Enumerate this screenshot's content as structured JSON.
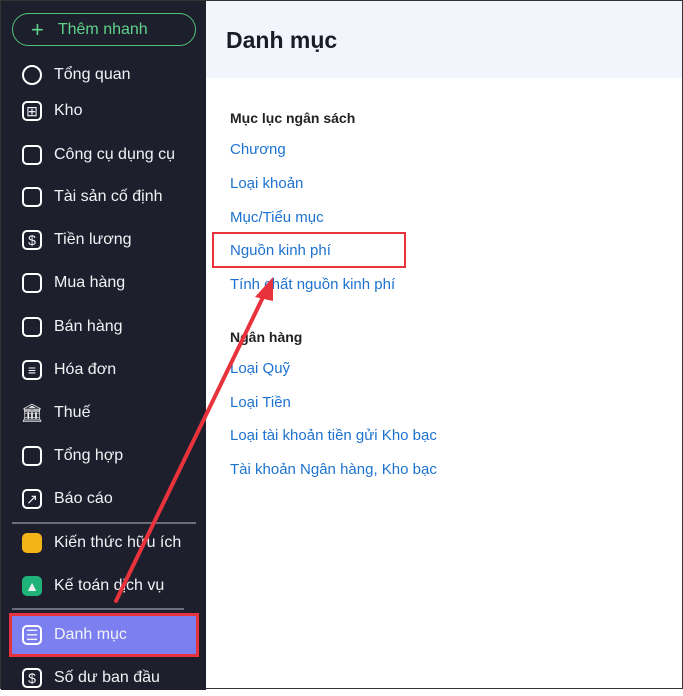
{
  "sidebar": {
    "quick_add": "Thêm nhanh",
    "items": [
      {
        "label": "Tổng quan",
        "icon": "pie-chart-icon"
      },
      {
        "label": "Kho",
        "icon": "warehouse-icon"
      },
      {
        "label": "Công cụ dụng cụ",
        "icon": "tools-icon"
      },
      {
        "label": "Tài sản cố định",
        "icon": "truck-icon"
      },
      {
        "label": "Tiền lương",
        "icon": "salary-bag-icon"
      },
      {
        "label": "Mua hàng",
        "icon": "cart-icon"
      },
      {
        "label": "Bán hàng",
        "icon": "store-icon"
      },
      {
        "label": "Hóa đơn",
        "icon": "invoice-icon"
      },
      {
        "label": "Thuế",
        "icon": "bank-icon"
      },
      {
        "label": "Tổng hợp",
        "icon": "summary-icon"
      },
      {
        "label": "Báo cáo",
        "icon": "report-icon"
      },
      {
        "label": "Kiến thức hữu ích",
        "icon": "knowledge-icon"
      },
      {
        "label": "Kế toán dịch vụ",
        "icon": "service-icon"
      },
      {
        "label": "Danh mục",
        "icon": "catalog-icon"
      },
      {
        "label": "Số dư ban đầu",
        "icon": "balance-icon"
      }
    ]
  },
  "main": {
    "title": "Danh mục",
    "sections": [
      {
        "title": "Mục lục ngân sách",
        "links": [
          "Chương",
          "Loại khoản",
          "Mục/Tiểu mục",
          "Nguồn kinh phí",
          "Tính chất nguồn kinh phí"
        ]
      },
      {
        "title": "Ngân hàng",
        "links": [
          "Loại Quỹ",
          "Loại Tiền",
          "Loại tài khoản tiền gửi Kho bạc",
          "Tài khoản Ngân hàng, Kho bạc"
        ]
      }
    ]
  },
  "colors": {
    "sidebar": "#1e1f2d",
    "active": "#7b7ff0",
    "link": "#1d72d0",
    "annotation": "#e8323c"
  }
}
